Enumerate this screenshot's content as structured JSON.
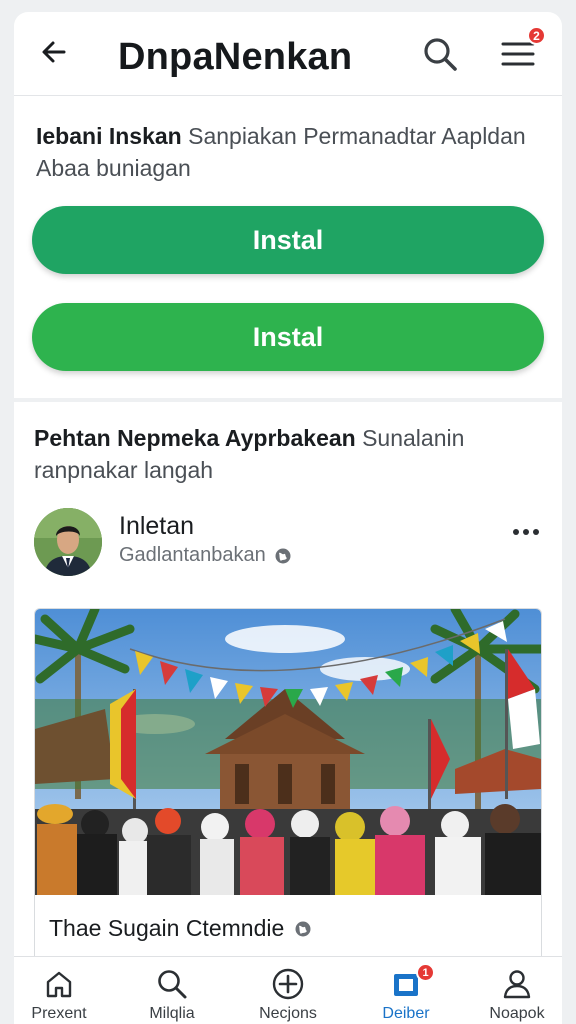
{
  "header": {
    "title": "DnpaNenkan",
    "menu_badge": "2",
    "back_icon": "arrow-left-icon",
    "search_icon": "search-icon",
    "menu_icon": "hamburger-menu-icon"
  },
  "install": {
    "lead": "Iebani Inskan",
    "text": " Sanpiakan Permanadtar Aapldan Abaa buniagan",
    "button1": "Instal",
    "button2": "Instal",
    "colors": {
      "button1": "#1fa463",
      "button2": "#2eb34e"
    }
  },
  "post": {
    "lead": "Pehtan Nepmeka Ayprbakean",
    "text": " Sunalanin ranpnakar langah",
    "author_name": "Inletan",
    "author_sub": "Gadlantanbakan",
    "caption": "Thae Sugain Ctemndie"
  },
  "nav": {
    "items": [
      {
        "label": "Prexent",
        "icon": "home-icon"
      },
      {
        "label": "Milqlia",
        "icon": "search-icon"
      },
      {
        "label": "Necjons",
        "icon": "add-circle-icon"
      },
      {
        "label": "Deiber",
        "icon": "pages-icon",
        "badge": "1",
        "active": true
      },
      {
        "label": "Noapok",
        "icon": "profile-icon"
      }
    ]
  },
  "colors": {
    "accent": "#1a73c8",
    "badge": "#e53935"
  }
}
